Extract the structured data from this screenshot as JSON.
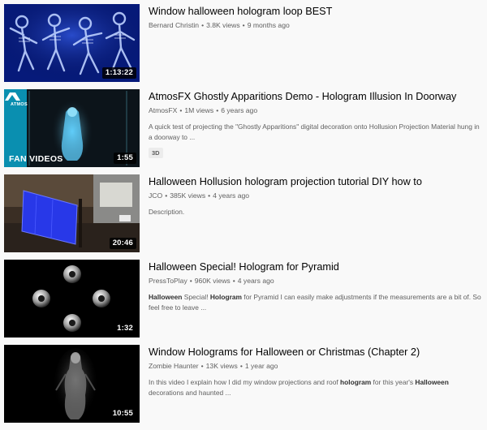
{
  "videos": [
    {
      "title": "Window halloween hologram loop BEST",
      "channel": "Bernard Christin",
      "views": "3.8K views",
      "age": "9 months ago",
      "duration": "1:13:22",
      "thumbnail_icon": "skeletons-thumbnail"
    },
    {
      "title": "AtmosFX Ghostly Apparitions Demo - Hologram Illusion In Doorway",
      "channel": "AtmosFX",
      "views": "1M views",
      "age": "6 years ago",
      "description": "A quick test of projecting the \"Ghostly Apparitions\" digital decoration onto Hollusion Projection Material hung in a doorway to ...",
      "badge": "3D",
      "duration": "1:55",
      "overlay_label": "FAN VIDEOS",
      "brand_tag": "ATMOS",
      "thumbnail_icon": "ghost-doorway-thumbnail"
    },
    {
      "title": "Halloween Hollusion hologram projection tutorial DIY how to",
      "channel": "JCO",
      "views": "385K views",
      "age": "4 years ago",
      "description": "Description.",
      "duration": "20:46",
      "thumbnail_icon": "projection-screen-thumbnail"
    },
    {
      "title": "Halloween Special! Hologram for Pyramid",
      "channel": "PressToPlay",
      "views": "960K views",
      "age": "4 years ago",
      "description_parts": [
        {
          "text": "Halloween",
          "bold": true
        },
        {
          "text": " Special! ",
          "bold": false
        },
        {
          "text": "Hologram",
          "bold": true
        },
        {
          "text": " for Pyramid I can easily make adjustments if the measurements are a bit of. So feel free to leave ...",
          "bold": false
        }
      ],
      "duration": "1:32",
      "thumbnail_icon": "eyeballs-thumbnail"
    },
    {
      "title": "Window Holograms for Halloween or Christmas (Chapter 2)",
      "channel": "Zombie Haunter",
      "views": "13K views",
      "age": "1 year ago",
      "description_parts": [
        {
          "text": "In this video I explain how I did my window projections and roof ",
          "bold": false
        },
        {
          "text": "hologram",
          "bold": true
        },
        {
          "text": " for this year's ",
          "bold": false
        },
        {
          "text": "Halloween",
          "bold": true
        },
        {
          "text": " decorations and haunted ...",
          "bold": false
        }
      ],
      "duration": "10:55",
      "thumbnail_icon": "ghost-figure-thumbnail"
    }
  ],
  "colors": {
    "page_bg": "#f9f9f9",
    "title": "#030303",
    "meta": "#606060",
    "duration_bg": "#000000",
    "hologram_blue": "#2a5cff",
    "teal_brand": "#0a8fb0"
  }
}
